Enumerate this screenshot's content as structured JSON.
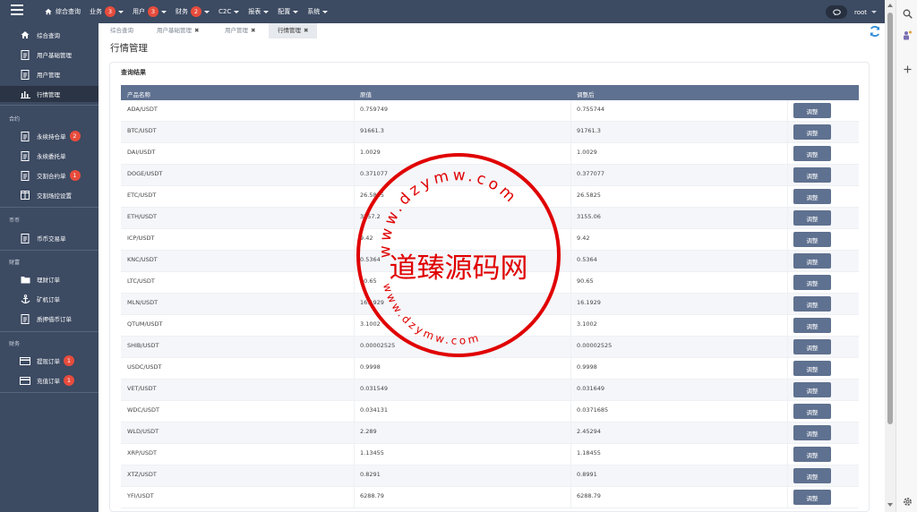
{
  "topbar": {
    "nav": [
      {
        "label": "综合查询",
        "icon": "home-icon"
      },
      {
        "label": "业务",
        "badge": "3",
        "caret": true
      },
      {
        "label": "用户",
        "badge": "3",
        "caret": true
      },
      {
        "label": "财务",
        "badge": "2",
        "caret": true
      },
      {
        "label": "C2C",
        "caret": true
      },
      {
        "label": "报表",
        "caret": true
      },
      {
        "label": "配置",
        "caret": true
      },
      {
        "label": "系统",
        "caret": true
      }
    ],
    "user": "root"
  },
  "sidebar": {
    "items_top": [
      {
        "label": "综合查询",
        "icon": "home-icon"
      },
      {
        "label": "用户基础管理",
        "icon": "document-icon"
      },
      {
        "label": "用户管理",
        "icon": "document-icon"
      },
      {
        "label": "行情管理",
        "icon": "bar-chart-icon",
        "active": true
      }
    ],
    "group_contract": "合约",
    "items_contract": [
      {
        "label": "永续持仓单",
        "icon": "document-icon",
        "badge": "2"
      },
      {
        "label": "永续委托单",
        "icon": "document-icon"
      },
      {
        "label": "交割合约单",
        "icon": "document-icon",
        "badge": "1"
      },
      {
        "label": "交割场控设置",
        "icon": "columns-icon"
      }
    ],
    "group_coin": "币币",
    "items_coin": [
      {
        "label": "币币交易单",
        "icon": "document-icon"
      }
    ],
    "group_wealth": "财富",
    "items_wealth": [
      {
        "label": "理财订单",
        "icon": "folder-icon"
      },
      {
        "label": "矿机订单",
        "icon": "anchor-icon"
      },
      {
        "label": "质押借币订单",
        "icon": "document-icon"
      }
    ],
    "group_finance": "财务",
    "items_finance": [
      {
        "label": "提现订单",
        "icon": "card-icon",
        "badge": "1"
      },
      {
        "label": "充值订单",
        "icon": "card-icon",
        "badge": "1"
      }
    ]
  },
  "tabs": [
    {
      "label": "综合查询",
      "close": false
    },
    {
      "label": "用户基础管理",
      "close": true
    },
    {
      "label": "用户管理",
      "close": true
    },
    {
      "label": "行情管理",
      "close": true,
      "active": true
    }
  ],
  "close_glyph": "✖",
  "page_title": "行情管理",
  "panel_title": "查询结果",
  "table": {
    "headers": [
      "产品名称",
      "原值",
      "调整后",
      ""
    ],
    "action_label": "调整",
    "rows": [
      [
        "ADA/USDT",
        "0.759749",
        "0.755744"
      ],
      [
        "BTC/USDT",
        "91661.3",
        "91761.3"
      ],
      [
        "DAI/USDT",
        "1.0029",
        "1.0029"
      ],
      [
        "DOGE/USDT",
        "0.371077",
        "0.377077"
      ],
      [
        "ETC/USDT",
        "26.5825",
        "26.5825"
      ],
      [
        "ETH/USDT",
        "3257.2",
        "3155.06"
      ],
      [
        "ICP/USDT",
        "9.42",
        "9.42"
      ],
      [
        "KNC/USDT",
        "0.5364",
        "0.5364"
      ],
      [
        "LTC/USDT",
        "90.65",
        "90.65"
      ],
      [
        "MLN/USDT",
        "16.1929",
        "16.1929"
      ],
      [
        "QTUM/USDT",
        "3.1002",
        "3.1002"
      ],
      [
        "SHIB/USDT",
        "0.00002525",
        "0.00002525"
      ],
      [
        "USDC/USDT",
        "0.9998",
        "0.9998"
      ],
      [
        "VET/USDT",
        "0.031549",
        "0.031649"
      ],
      [
        "WDC/USDT",
        "0.034131",
        "0.0371685"
      ],
      [
        "WLD/USDT",
        "2.289",
        "2.45294"
      ],
      [
        "XRP/USDT",
        "1.13455",
        "1.18455"
      ],
      [
        "XTZ/USDT",
        "0.8291",
        "0.8991"
      ],
      [
        "YFI/USDT",
        "6288.79",
        "6288.79"
      ]
    ]
  },
  "watermark": {
    "center_text": "道臻源码网",
    "ring_top": "www.dzymw.com",
    "ring_bottom": "www.dzymw.com",
    "color": "#e00000"
  },
  "colors": {
    "sidebar": "#3c4a62",
    "table_header": "#5f7190",
    "badge": "#e74c3c",
    "refresh": "#2d8ad8"
  }
}
